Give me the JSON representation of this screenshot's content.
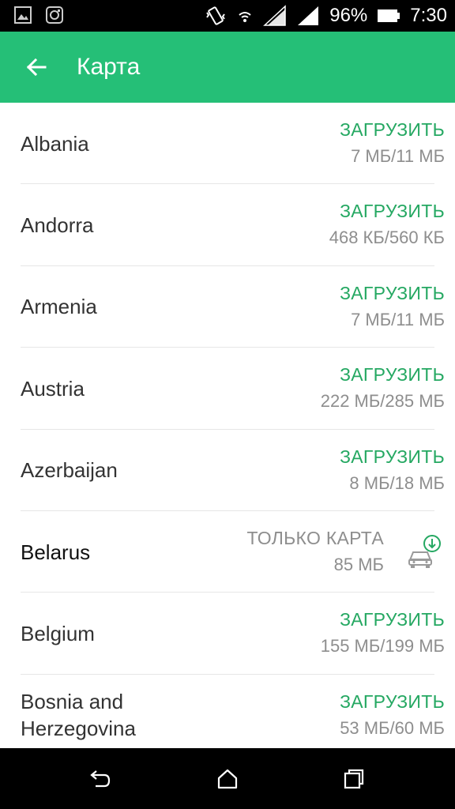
{
  "status_bar": {
    "battery": "96%",
    "time": "7:30"
  },
  "app_bar": {
    "title": "Карта"
  },
  "countries": [
    {
      "name": "Albania",
      "action": "ЗАГРУЗИТЬ",
      "size": "7 МБ/11 МБ"
    },
    {
      "name": "Andorra",
      "action": "ЗАГРУЗИТЬ",
      "size": "468 КБ/560 КБ"
    },
    {
      "name": "Armenia",
      "action": "ЗАГРУЗИТЬ",
      "size": "7 МБ/11 МБ"
    },
    {
      "name": "Austria",
      "action": "ЗАГРУЗИТЬ",
      "size": "222 МБ/285 МБ"
    },
    {
      "name": "Azerbaijan",
      "action": "ЗАГРУЗИТЬ",
      "size": "8 МБ/18 МБ"
    },
    {
      "name": "Belarus",
      "action": "ТОЛЬКО КАРТА",
      "size": "85 МБ"
    },
    {
      "name": "Belgium",
      "action": "ЗАГРУЗИТЬ",
      "size": "155 МБ/199 МБ"
    },
    {
      "name": "Bosnia and Herzegovina",
      "name_line1": "Bosnia and",
      "name_line2": "Herzegovina",
      "action": "ЗАГРУЗИТЬ",
      "size": "53 МБ/60 МБ"
    }
  ],
  "colors": {
    "accent": "#25bf77",
    "action_text": "#25a862",
    "secondary_text": "#8e8e8e"
  },
  "icons": {
    "back": "arrow-left-icon",
    "car_download": "car-download-icon",
    "nav_back": "nav-back-icon",
    "nav_home": "nav-home-icon",
    "nav_recents": "nav-recents-icon"
  }
}
